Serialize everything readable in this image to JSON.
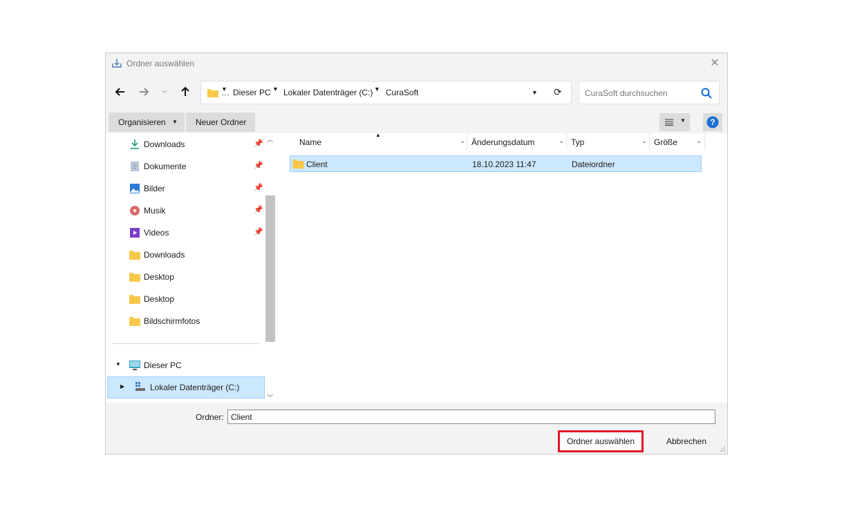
{
  "window": {
    "title": "Ordner auswählen",
    "close_glyph": "✕"
  },
  "nav": {
    "back_glyph": "🡐",
    "forward_glyph": "🡒",
    "recent_glyph": "⌄",
    "up_glyph": "🡑",
    "refresh_glyph": "⟳",
    "breadcrumb": [
      {
        "label": "…"
      },
      {
        "label": "Dieser PC"
      },
      {
        "label": "Lokaler Datenträger (C:)"
      },
      {
        "label": "CuraSoft"
      }
    ],
    "search_placeholder": "CuraSoft durchsuchen"
  },
  "toolbar": {
    "organize_label": "Organisieren",
    "new_folder_label": "Neuer Ordner"
  },
  "sidebar": {
    "items": [
      {
        "label": "Downloads",
        "icon": "download-icon",
        "pinned": true
      },
      {
        "label": "Dokumente",
        "icon": "documents-icon",
        "pinned": true
      },
      {
        "label": "Bilder",
        "icon": "pictures-icon",
        "pinned": true
      },
      {
        "label": "Musik",
        "icon": "music-icon",
        "pinned": true
      },
      {
        "label": "Videos",
        "icon": "videos-icon",
        "pinned": true
      },
      {
        "label": "Downloads",
        "icon": "folder-icon",
        "pinned": false
      },
      {
        "label": "Desktop",
        "icon": "folder-icon",
        "pinned": false
      },
      {
        "label": "Desktop",
        "icon": "folder-icon",
        "pinned": false
      },
      {
        "label": "Bildschirmfotos",
        "icon": "folder-icon",
        "pinned": false
      }
    ],
    "this_pc_label": "Dieser PC",
    "local_disk_label": "Lokaler Datenträger (C:)"
  },
  "files": {
    "columns": [
      "Name",
      "Änderungsdatum",
      "Typ",
      "Größe"
    ],
    "rows": [
      {
        "name": "Client",
        "date": "18.10.2023 11:47",
        "type": "Dateiordner",
        "size": ""
      }
    ]
  },
  "footer": {
    "folder_label": "Ordner:",
    "folder_value": "Client",
    "ok_label": "Ordner auswählen",
    "cancel_label": "Abbrechen"
  },
  "colors": {
    "selection": "#cce8ff",
    "highlight_border": "#e0182b",
    "folder": "#f8c948",
    "accent": "#0a6cd8"
  }
}
